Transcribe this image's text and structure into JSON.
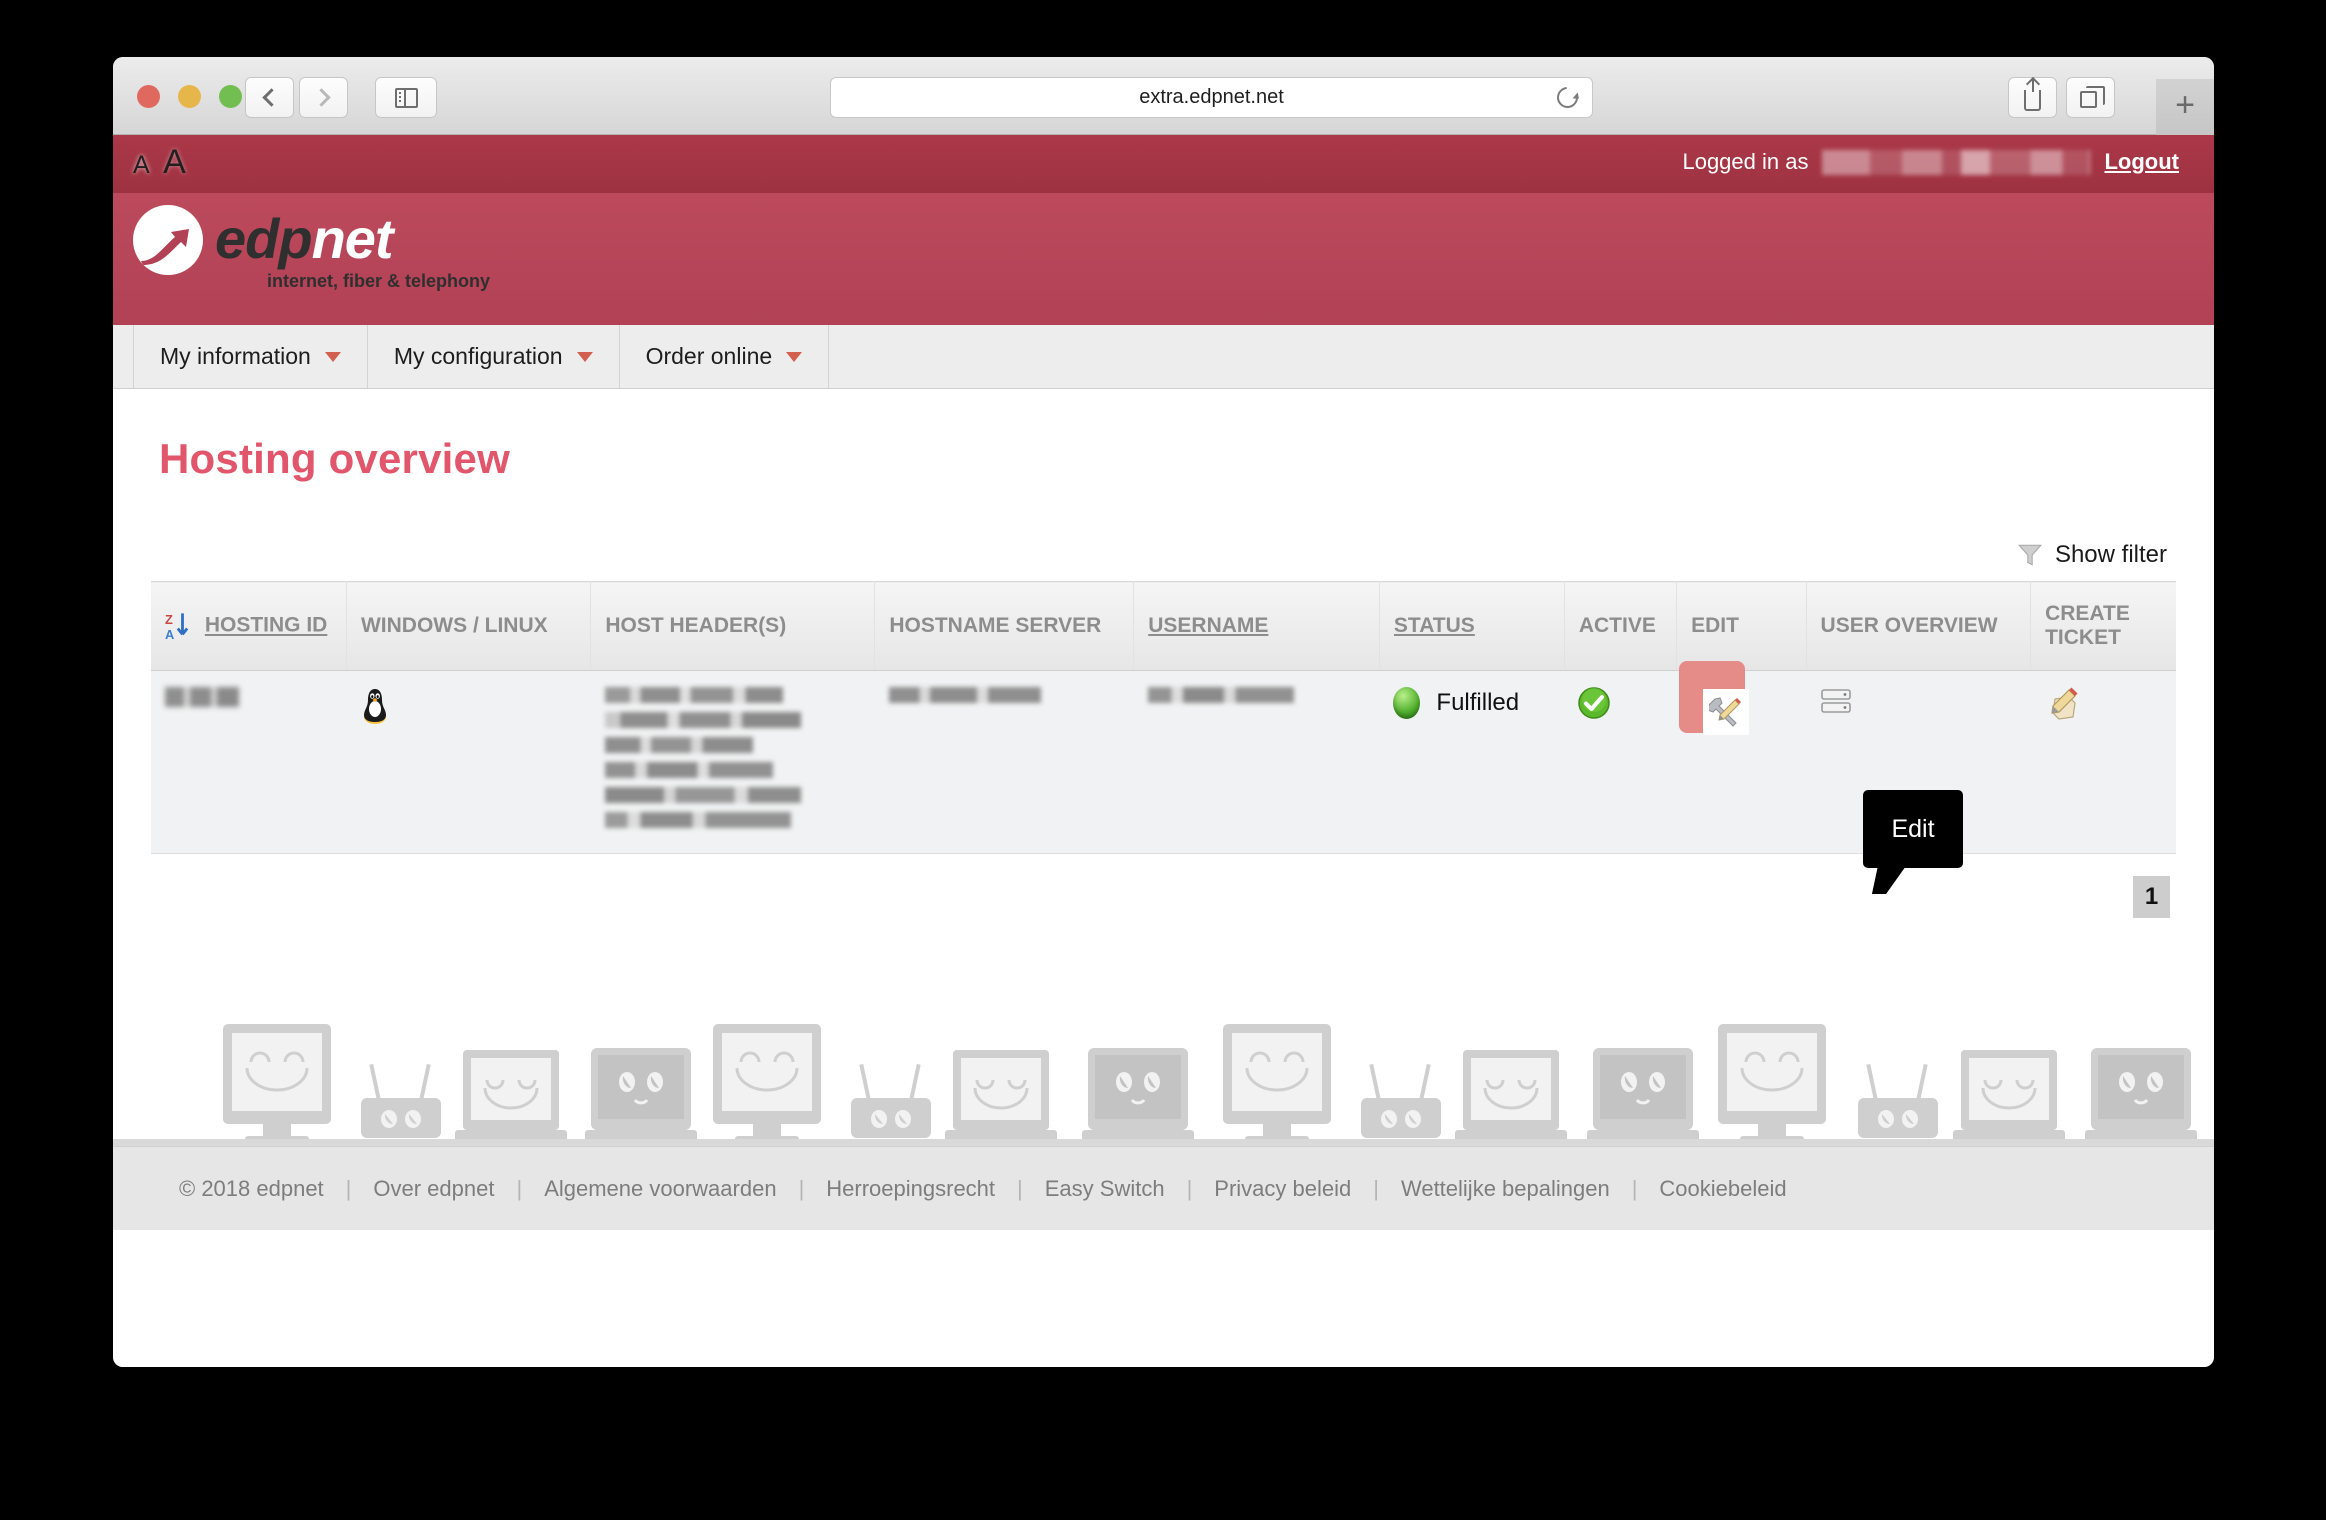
{
  "browser": {
    "url": "extra.edpnet.net",
    "back_label": "Back",
    "forward_label": "Forward",
    "sidebar_label": "Show sidebar",
    "reload_label": "Reload",
    "share_label": "Share",
    "tabs_label": "Show tabs",
    "newtab_label": "+"
  },
  "topbar": {
    "text_small": "A",
    "text_large": "A",
    "logged_in_label": "Logged in as",
    "logged_in_user": "",
    "logout_label": "Logout"
  },
  "brand": {
    "name_dark": "edp",
    "name_light": "net",
    "tagline": "internet, fiber & telephony"
  },
  "nav": {
    "items": [
      {
        "label": "My information"
      },
      {
        "label": "My configuration"
      },
      {
        "label": "Order online"
      }
    ]
  },
  "page": {
    "title": "Hosting overview",
    "filter_label": "Show filter",
    "pagination": {
      "current": "1"
    }
  },
  "table": {
    "columns": [
      {
        "label": "HOSTING ID",
        "sortable": true,
        "sort_icon": "sort-za-icon"
      },
      {
        "label": "WINDOWS / LINUX",
        "sortable": false
      },
      {
        "label": "HOST HEADER(S)",
        "sortable": false
      },
      {
        "label": "HOSTNAME SERVER",
        "sortable": false
      },
      {
        "label": "USERNAME",
        "sortable": true
      },
      {
        "label": "STATUS",
        "sortable": true
      },
      {
        "label": "ACTIVE",
        "sortable": false
      },
      {
        "label": "EDIT",
        "sortable": false
      },
      {
        "label": "USER OVERVIEW",
        "sortable": false
      },
      {
        "label": "CREATE TICKET",
        "sortable": false
      }
    ],
    "rows": [
      {
        "hosting_id": "",
        "os_icon": "linux-tux-icon",
        "host_headers": [
          "",
          "",
          "",
          "",
          "",
          ""
        ],
        "hostname_server": "",
        "username": "",
        "status": "Fulfilled",
        "active_icon": "green-check-icon",
        "edit_icon": "wrench-pencil-icon",
        "user_overview_icon": "server-list-icon",
        "create_ticket_icon": "pencil-note-icon"
      }
    ]
  },
  "tooltip": {
    "text": "Edit"
  },
  "footer": {
    "copyright": "© 2018 edpnet",
    "links": [
      "Over edpnet",
      "Algemene voorwaarden",
      "Herroepingsrecht",
      "Easy Switch",
      "Privacy beleid",
      "Wettelijke bepalingen",
      "Cookiebeleid"
    ],
    "separator": "|"
  },
  "colors": {
    "brand_red": "#b24156",
    "topbar_red": "#a33848",
    "title_pink": "#e2566b",
    "highlight": "#e58b88",
    "status_green": "#4fae2c"
  }
}
